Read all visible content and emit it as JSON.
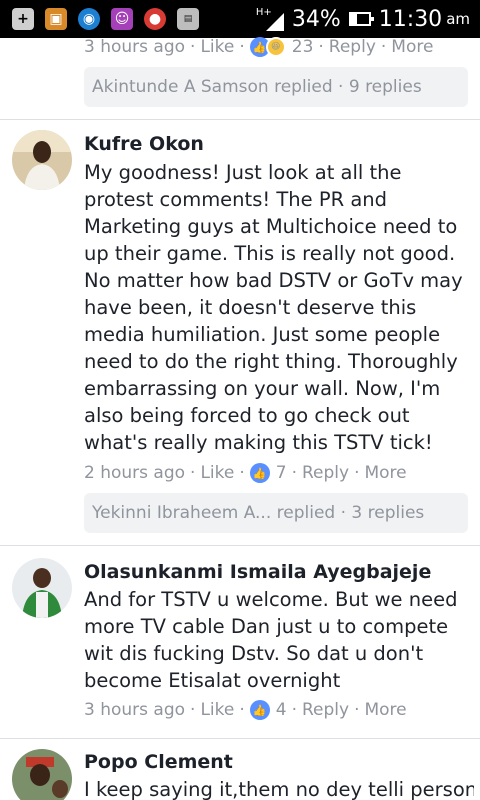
{
  "status_bar": {
    "signal_type": "H+",
    "battery_percent": "34%",
    "battery_level": 0.34,
    "time": "11:30",
    "ampm": "am"
  },
  "comments": [
    {
      "meta": {
        "time": "3 hours ago",
        "like": "Like",
        "reaction_count": "23",
        "reply": "Reply",
        "more": "More"
      },
      "replies": "Akintunde A Samson replied · 9 replies"
    },
    {
      "author": "Kufre Okon",
      "text": "My goodness! Just look at all the protest comments! The PR and Marketing guys at Multichoice need to up their game. This is really not good. No matter how bad DSTV or GoTv may have been, it doesn't deserve this media humiliation. Just some people need to do the right thing. Thoroughly embarrassing on your wall. Now, I'm also being forced to go check out what's really making this TSTV tick!",
      "meta": {
        "time": "2 hours ago",
        "like": "Like",
        "reaction_count": "7",
        "reply": "Reply",
        "more": "More"
      },
      "replies": "Yekinni Ibraheem A... replied · 3 replies"
    },
    {
      "author": "Olasunkanmi Ismaila Ayegbajeje",
      "text": "And for TSTV u welcome. But we need more TV cable Dan just u to compete wit dis fucking Dstv. So dat u don't become Etisalat overnight",
      "meta": {
        "time": "3 hours ago",
        "like": "Like",
        "reaction_count": "4",
        "reply": "Reply",
        "more": "More"
      }
    },
    {
      "author": "Popo Clement",
      "text": "I keep saying it,them no dey telli person"
    }
  ],
  "colors": {
    "like_blue": "#5890ff",
    "meta_gray": "#90949c",
    "reply_box_bg": "#f1f2f4"
  }
}
